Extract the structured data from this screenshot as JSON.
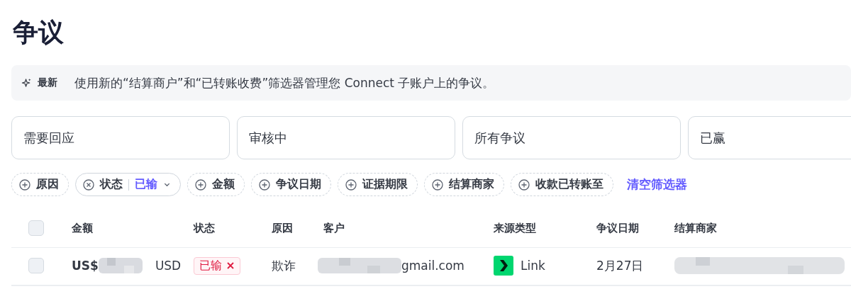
{
  "page": {
    "title": "争议"
  },
  "banner": {
    "badge": "最新",
    "text": "使用新的“结算商户”和“已转账收费”筛选器管理您 Connect 子账户上的争议。"
  },
  "tabs": [
    {
      "label": "需要回应",
      "selected": false
    },
    {
      "label": "审核中",
      "selected": false
    },
    {
      "label": "所有争议",
      "selected": false
    },
    {
      "label": "已赢",
      "selected": false
    }
  ],
  "filters": [
    {
      "kind": "add",
      "label": "原因"
    },
    {
      "kind": "active",
      "label": "状态",
      "value": "已输"
    },
    {
      "kind": "add",
      "label": "金额"
    },
    {
      "kind": "add",
      "label": "争议日期"
    },
    {
      "kind": "add",
      "label": "证据期限"
    },
    {
      "kind": "add",
      "label": "结算商家"
    },
    {
      "kind": "add",
      "label": "收款已转账至"
    }
  ],
  "clear_filters": "清空筛选器",
  "table": {
    "columns": [
      "金额",
      "状态",
      "原因",
      "客户",
      "来源类型",
      "争议日期",
      "结算商家"
    ],
    "select_all_checked": false,
    "rows": [
      {
        "checked": false,
        "amount": "US$",
        "currency": "USD",
        "status": "已输",
        "reason": "欺诈",
        "customer": "gmail.com",
        "source": "Link",
        "date": "2月27日"
      }
    ]
  }
}
